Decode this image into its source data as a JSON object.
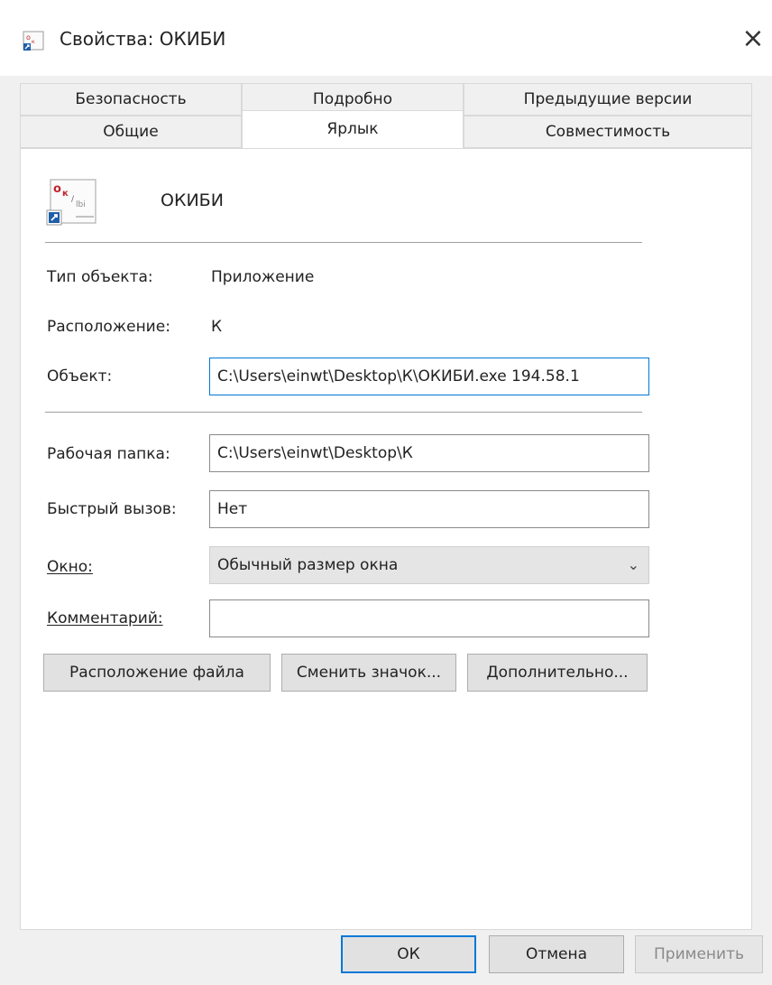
{
  "window": {
    "title": "Свойства: ОКИБИ",
    "close_label": "×",
    "icon": "shortcut-app-icon"
  },
  "tabs": {
    "row1": [
      "Безопасность",
      "Подробно",
      "Предыдущие версии"
    ],
    "row2": [
      "Общие",
      "Ярлык",
      "Совместимость"
    ],
    "active": "Ярлык"
  },
  "shortcut": {
    "name": "ОКИБИ",
    "type_label": "Тип объекта:",
    "type_value": "Приложение",
    "location_label": "Расположение:",
    "location_value": "К",
    "target_label": "Объект:",
    "target_value": "C:\\Users\\einwt\\Desktop\\К\\ОКИБИ.exe 194.58.1",
    "workdir_label": "Рабочая папка:",
    "workdir_value": "C:\\Users\\einwt\\Desktop\\К",
    "hotkey_label": "Быстрый вызов:",
    "hotkey_value": "Нет",
    "window_label": "Окно:",
    "window_value": "Обычный размер окна",
    "comment_label": "Комментарий:",
    "comment_value": ""
  },
  "actions": {
    "open_location": "Расположение файла",
    "change_icon": "Сменить значок...",
    "advanced": "Дополнительно..."
  },
  "footer": {
    "ok": "ОК",
    "cancel": "Отмена",
    "apply": "Применить"
  }
}
